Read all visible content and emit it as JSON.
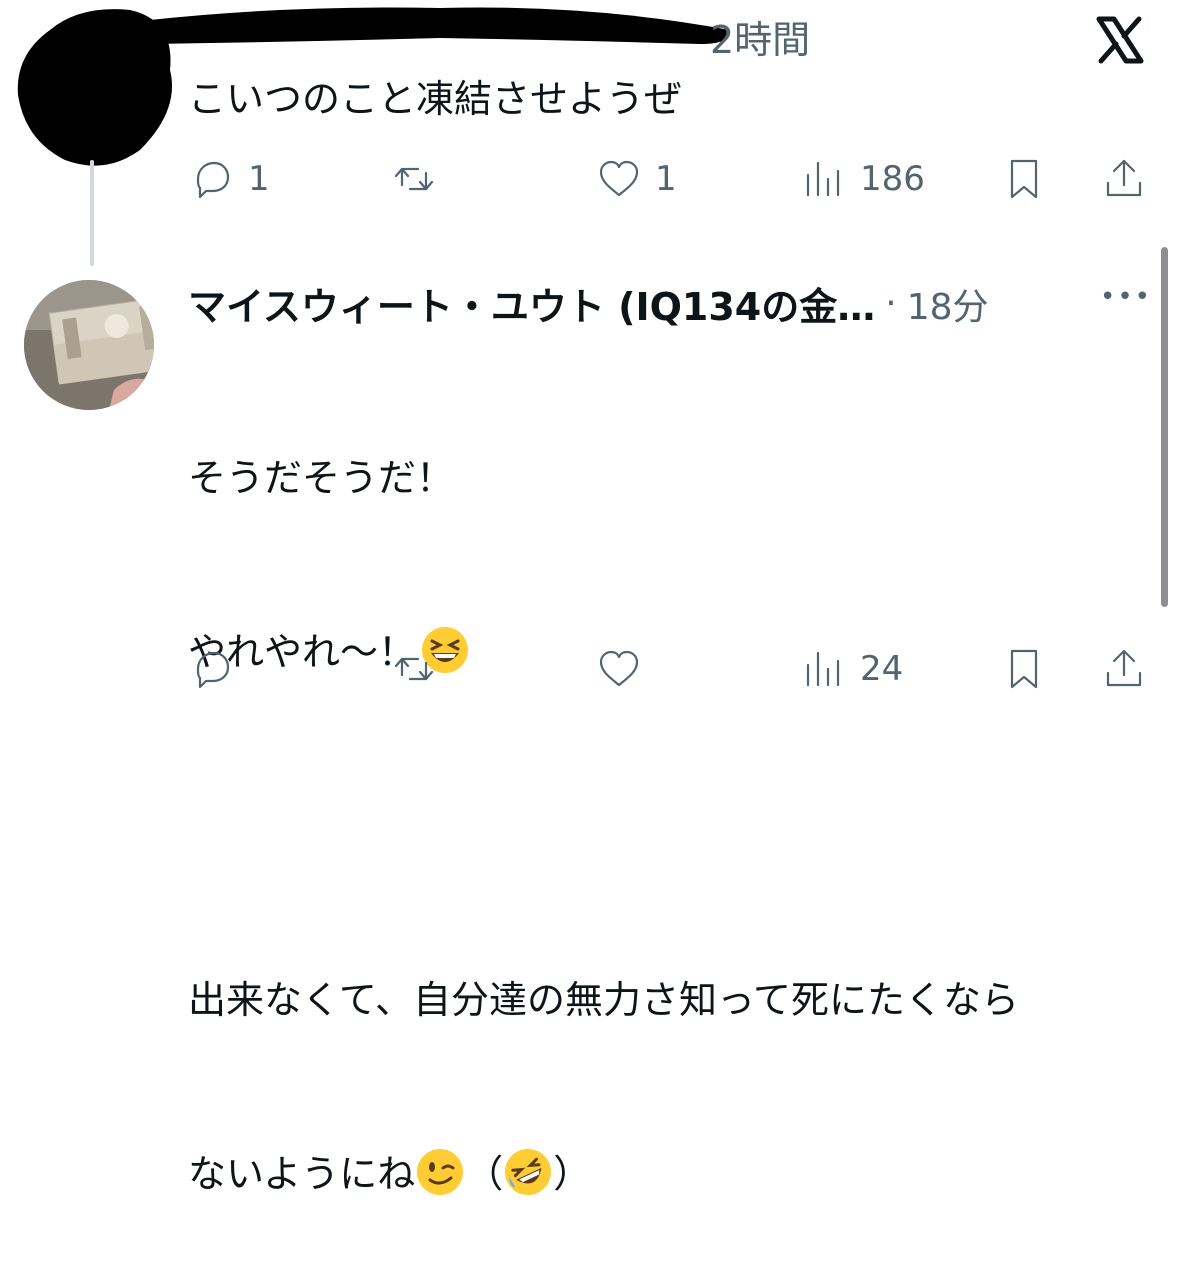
{
  "x_logo": "X",
  "tweet1": {
    "time": "2時間",
    "text": "こいつのこと凍結させようぜ",
    "replies": "1",
    "likes": "1",
    "views": "186"
  },
  "tweet2": {
    "name": "マイスウィート・ユウト (IQ134の金…",
    "dot": "·",
    "time": "18分",
    "more": "•••",
    "line1": "そうだそうだ！",
    "line2": "やれやれ〜！",
    "line3": "出来なくて、自分達の無力さ知って死にたくなら",
    "line4": "ないようにね",
    "paren_open": "（",
    "paren_close": "）",
    "views": "24"
  },
  "colors": {
    "text": "#0f1419",
    "muted": "#536471",
    "thread_line": "#cfd9de"
  }
}
